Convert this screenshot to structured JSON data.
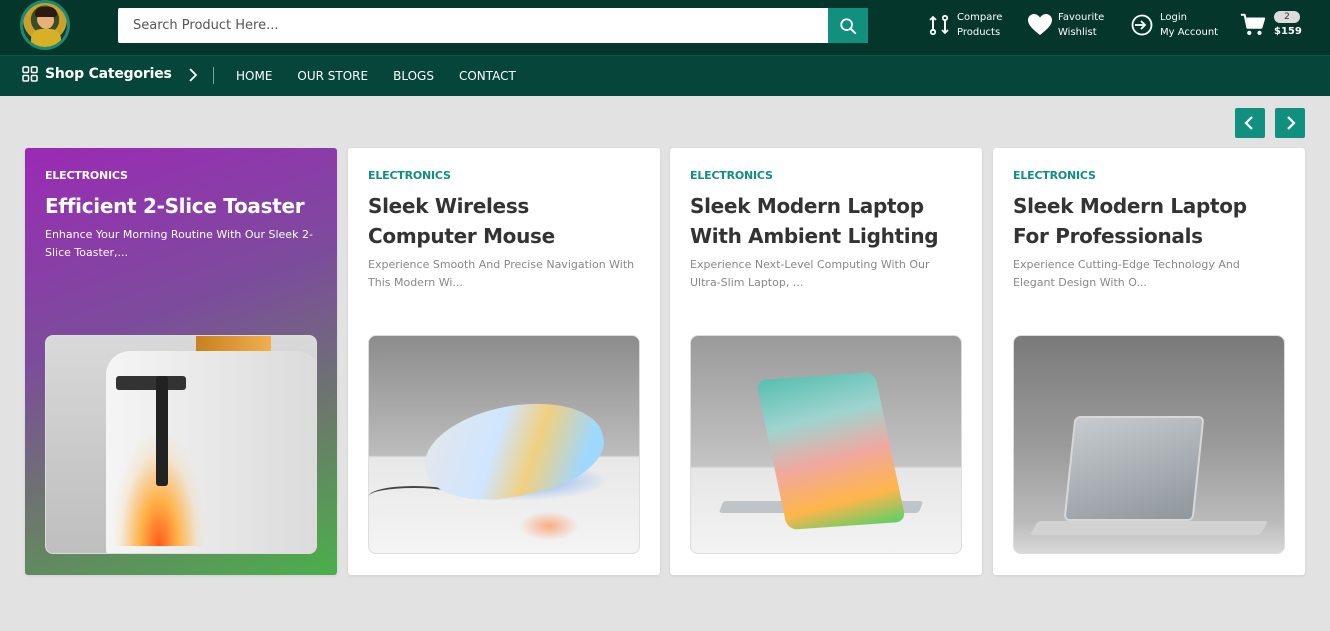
{
  "header": {
    "search_placeholder": "Search Product Here...",
    "links": [
      {
        "line1": "Compare",
        "line2": "Products",
        "icon": "compare-icon"
      },
      {
        "line1": "Favourite",
        "line2": "Wishlist",
        "icon": "heart-icon"
      },
      {
        "line1": "Login",
        "line2": "My Account",
        "icon": "login-icon"
      }
    ],
    "cart": {
      "count": "2",
      "total": "$159",
      "icon": "cart-icon"
    }
  },
  "nav": {
    "categories_label": "Shop Categories",
    "menu": [
      "HOME",
      "OUR STORE",
      "BLOGS",
      "CONTACT"
    ]
  },
  "products": [
    {
      "category": "ELECTRONICS",
      "title": "Efficient 2-Slice Toaster",
      "description": "Enhance Your Morning Routine With Our Sleek 2-Slice Toaster,..."
    },
    {
      "category": "ELECTRONICS",
      "title": "Sleek Wireless Computer Mouse",
      "description": "Experience Smooth And Precise Navigation With This Modern Wi..."
    },
    {
      "category": "ELECTRONICS",
      "title": "Sleek Modern Laptop With Ambient Lighting",
      "description": "Experience Next-Level Computing With Our Ultra-Slim Laptop, ..."
    },
    {
      "category": "ELECTRONICS",
      "title": "Sleek Modern Laptop For Professionals",
      "description": "Experience Cutting-Edge Technology And Elegant Design With O..."
    }
  ],
  "colors": {
    "header_bg": "#04362c",
    "nav_bg": "#06463a",
    "accent": "#12907f"
  }
}
